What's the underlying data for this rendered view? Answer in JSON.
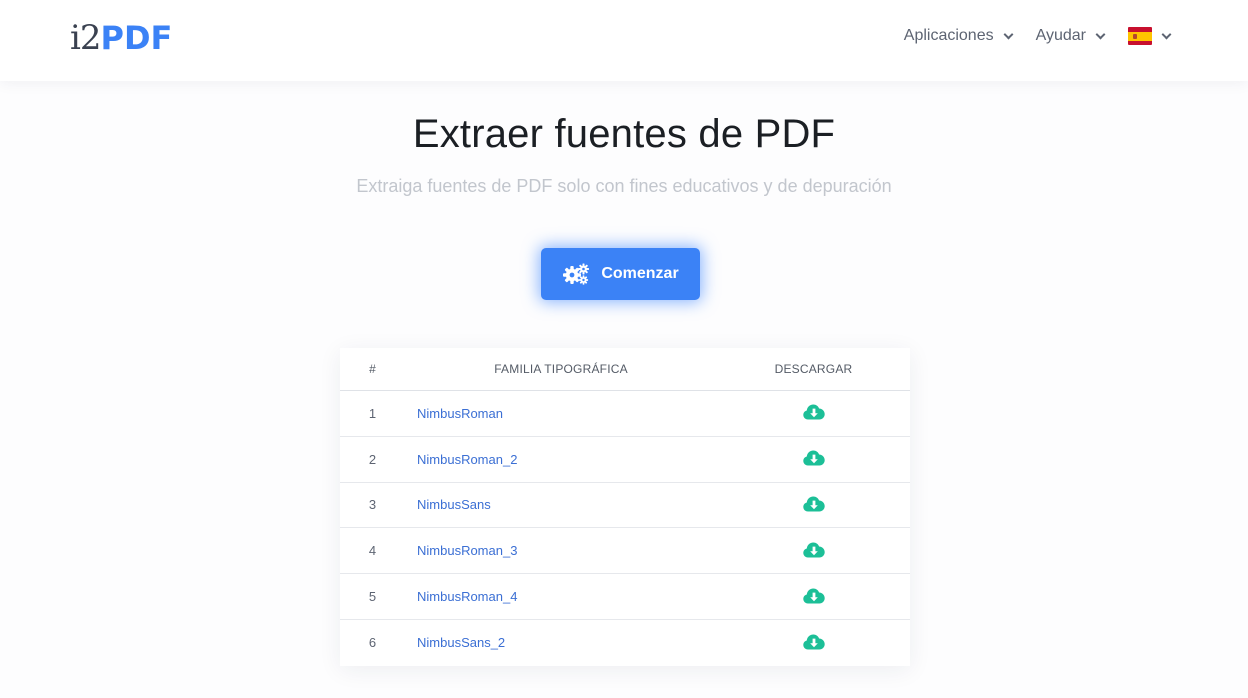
{
  "header": {
    "logo": {
      "part1": "i2",
      "part2": "PDF"
    },
    "nav": [
      {
        "label": "Aplicaciones"
      },
      {
        "label": "Ayudar"
      }
    ],
    "language_flag": "spain-flag-icon"
  },
  "hero": {
    "title": "Extraer fuentes de PDF",
    "subtitle": "Extraiga fuentes de PDF solo con fines educativos y de depuración",
    "button_label": "Comenzar",
    "button_icon": "gears-icon"
  },
  "table": {
    "headers": {
      "num": "#",
      "family": "FAMILIA TIPOGRÁFICA",
      "download": "DESCARGAR"
    },
    "rows": [
      {
        "num": "1",
        "family": "NimbusRoman"
      },
      {
        "num": "2",
        "family": "NimbusRoman_2"
      },
      {
        "num": "3",
        "family": "NimbusSans"
      },
      {
        "num": "4",
        "family": "NimbusRoman_3"
      },
      {
        "num": "5",
        "family": "NimbusRoman_4"
      },
      {
        "num": "6",
        "family": "NimbusSans_2"
      }
    ],
    "download_icon": "cloud-download-icon"
  },
  "colors": {
    "accent": "#3b82f6",
    "link": "#3b6fd4",
    "download_icon": "#1cbf97"
  }
}
